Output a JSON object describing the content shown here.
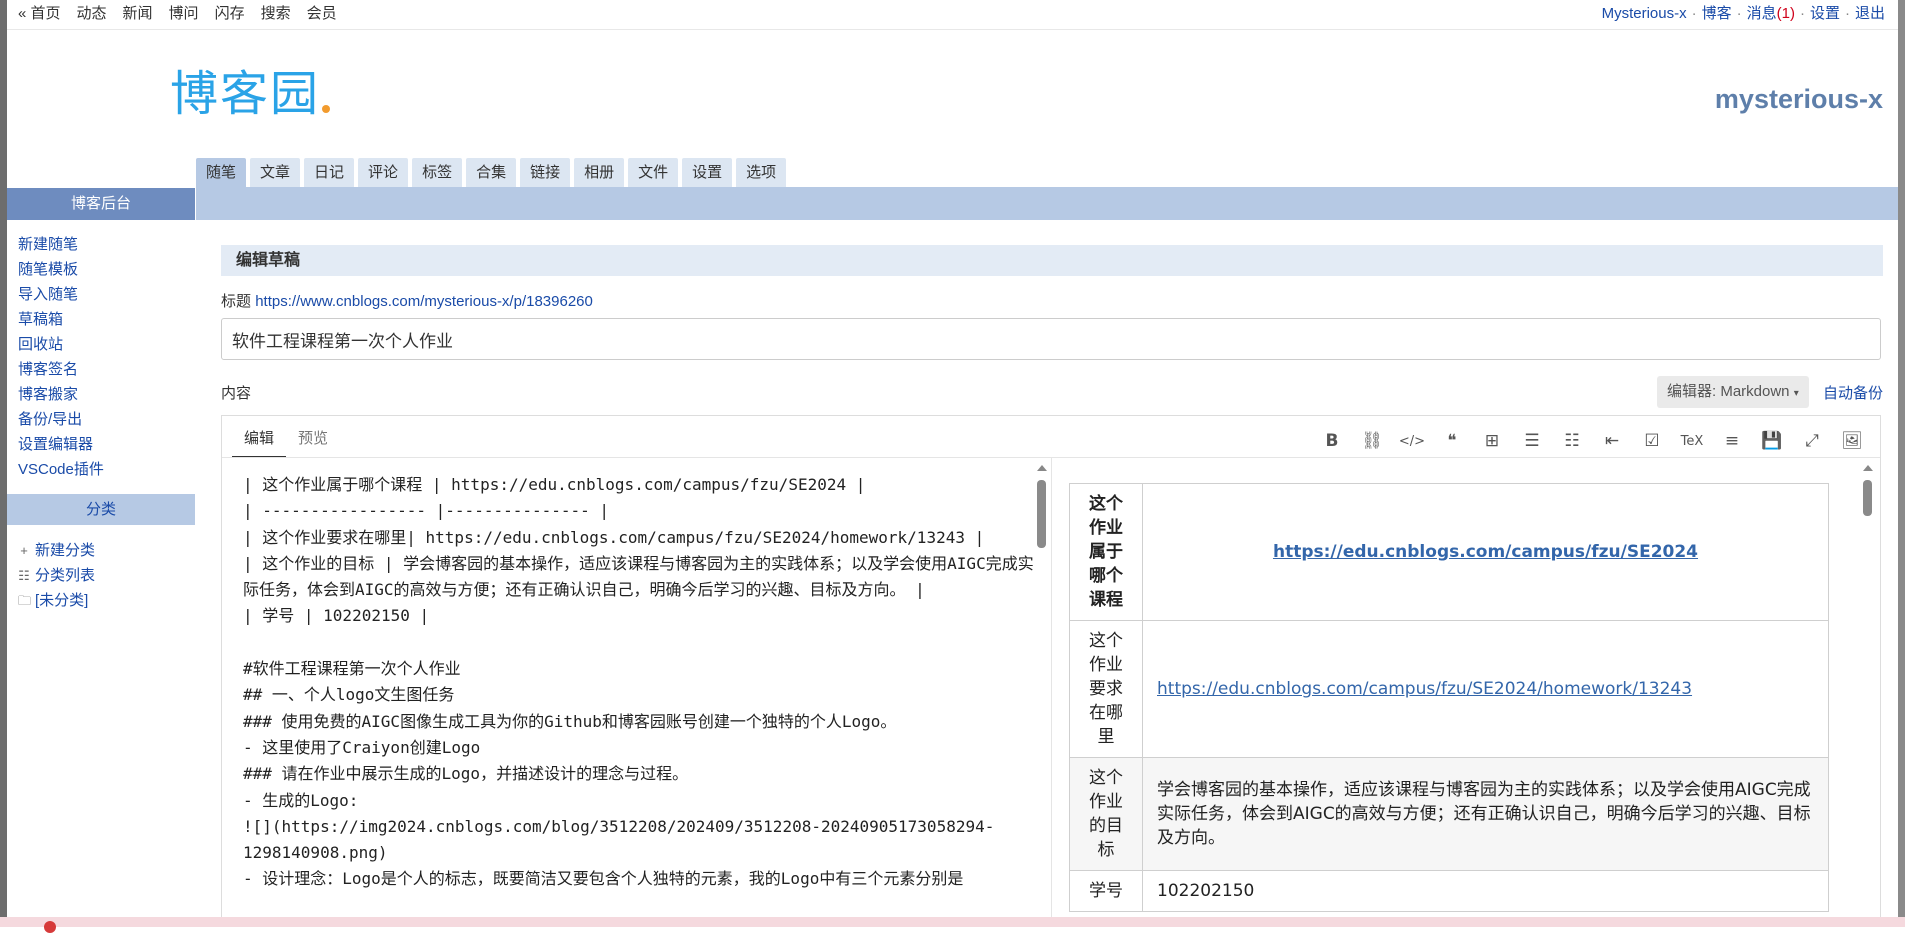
{
  "topnav": [
    "« 首页",
    "动态",
    "新闻",
    "博问",
    "闪存",
    "搜索",
    "会员"
  ],
  "topright": {
    "user": "Mysterious-x",
    "blog": "博客",
    "messages": "消息",
    "message_count": "(1)",
    "settings": "设置",
    "logout": "退出",
    "separator": "·"
  },
  "logo": {
    "text": "博客园"
  },
  "blog_name": "mysterious-x",
  "tabs": [
    "随笔",
    "文章",
    "日记",
    "评论",
    "标签",
    "合集",
    "链接",
    "相册",
    "文件",
    "设置",
    "选项"
  ],
  "sidebar": {
    "header": "博客后台",
    "links": [
      "新建随笔",
      "随笔模板",
      "导入随笔",
      "草稿箱",
      "回收站",
      "博客签名",
      "博客搬家",
      "备份/导出",
      "设置编辑器",
      "VSCode插件"
    ],
    "category_header": "分类",
    "categories": [
      {
        "icon": "plus-icon",
        "label": "新建分类"
      },
      {
        "icon": "list-icon",
        "label": "分类列表"
      },
      {
        "icon": "folder-icon",
        "label": "[未分类]"
      }
    ]
  },
  "main": {
    "section_title": "编辑草稿",
    "title_label": "标题",
    "title_link": "https://www.cnblogs.com/mysterious-x/p/18396260",
    "title_value": "软件工程课程第一次个人作业",
    "content_label": "内容",
    "editor_select": "编辑器: Markdown",
    "auto_backup": "自动备份"
  },
  "editor": {
    "tabs": [
      "编辑",
      "预览"
    ],
    "toolbar_icons": [
      "bold-icon",
      "link-icon",
      "code-icon",
      "quote-icon",
      "table-icon",
      "bullet-list-icon",
      "numbered-list-icon",
      "outdent-icon",
      "checkbox-icon",
      "tex-icon",
      "align-icon",
      "save-icon",
      "fullscreen-icon",
      "image-icon"
    ],
    "toolbar_glyphs": [
      "B",
      "⛓",
      "</>",
      "❝",
      "⊞",
      "☰",
      "☷",
      "⇤",
      "☑",
      "TeX",
      "≡",
      "💾",
      "⤢",
      "🖼"
    ],
    "markdown_lines": [
      "| 这个作业属于哪个课程 | https://edu.cnblogs.com/campus/fzu/SE2024 |",
      "| ----------------- |--------------- |",
      "| 这个作业要求在哪里| https://edu.cnblogs.com/campus/fzu/SE2024/homework/13243 |",
      "| 这个作业的目标 | 学会博客园的基本操作，适应该课程与博客园为主的实践体系；以及学会使用AIGC完成实际任务，体会到AIGC的高效与方便；还有正确认识自己，明确今后学习的兴趣、目标及方向。 |",
      "| 学号 | 102202150 |",
      "",
      "#软件工程课程第一次个人作业",
      "## 一、个人logo文生图任务",
      "### 使用免费的AIGC图像生成工具为你的Github和博客园账号创建一个独特的个人Logo。",
      "- 这里使用了Craiyon创建Logo",
      "### 请在作业中展示生成的Logo，并描述设计的理念与过程。",
      "- 生成的Logo:",
      "![](https://img2024.cnblogs.com/blog/3512208/202409/3512208-20240905173058294-1298140908.png)",
      "- 设计理念：Logo是个人的标志，既要简洁又要包含个人独特的元素，我的Logo中有三个元素分别是"
    ]
  },
  "preview": {
    "rows": [
      {
        "key": "这个作业属于哪个课程",
        "value": "https://edu.cnblogs.com/campus/fzu/SE2024",
        "link": true
      },
      {
        "key": "这个作业要求在哪里",
        "value": "https://edu.cnblogs.com/campus/fzu/SE2024/homework/13243",
        "link": true
      },
      {
        "key": "这个作业的目标",
        "value": "学会博客园的基本操作，适应该课程与博客园为主的实践体系；以及学会使用AIGC完成实际任务，体会到AIGC的高效与方便；还有正确认识自己，明确今后学习的兴趣、目标及方向。",
        "link": false
      },
      {
        "key": "学号",
        "value": "102202150",
        "link": false
      }
    ]
  },
  "colors": {
    "accent_blue": "#1a4ba8",
    "tab_band": "#b6c9e4",
    "sidebar_header": "#6e8cbf",
    "logo_blue": "#2aa3e7",
    "blog_name": "#5e7faa"
  }
}
